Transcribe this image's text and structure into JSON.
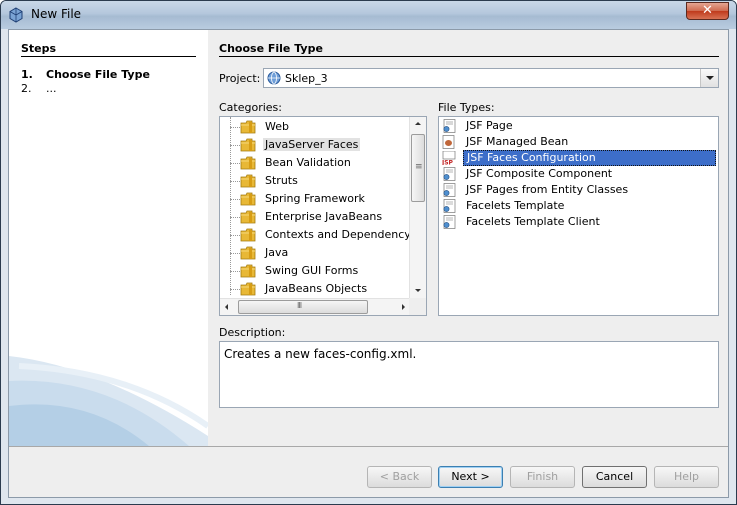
{
  "window": {
    "title": "New File"
  },
  "steps": {
    "heading": "Steps",
    "items": [
      {
        "num": "1.",
        "label": "Choose File Type"
      },
      {
        "num": "2.",
        "label": "..."
      }
    ]
  },
  "main": {
    "heading": "Choose File Type",
    "project_label": "Project:",
    "project_value": "Sklep_3",
    "categories_label": "Categories:",
    "file_types_label": "File Types:",
    "categories": [
      "Web",
      "JavaServer Faces",
      "Bean Validation",
      "Struts",
      "Spring Framework",
      "Enterprise JavaBeans",
      "Contexts and Dependency Injection",
      "Java",
      "Swing GUI Forms",
      "JavaBeans Objects"
    ],
    "selected_category": "JavaServer Faces",
    "file_types": [
      {
        "label": "JSF Page",
        "icon": "jsf-page-icon"
      },
      {
        "label": "JSF Managed Bean",
        "icon": "bean-icon"
      },
      {
        "label": "JSF Faces Configuration",
        "icon": "faces-config-icon"
      },
      {
        "label": "JSF Composite Component",
        "icon": "component-icon"
      },
      {
        "label": "JSF Pages from Entity Classes",
        "icon": "jsf-page-icon"
      },
      {
        "label": "Facelets Template",
        "icon": "template-icon"
      },
      {
        "label": "Facelets Template Client",
        "icon": "template-icon"
      }
    ],
    "selected_file_type": "JSF Faces Configuration",
    "description_label": "Description:",
    "description": "Creates a new faces-config.xml."
  },
  "buttons": {
    "back": "< Back",
    "next": "Next >",
    "finish": "Finish",
    "cancel": "Cancel",
    "help": "Help"
  },
  "colors": {
    "selection": "#3d6ec9",
    "panel": "#eeeeee"
  }
}
